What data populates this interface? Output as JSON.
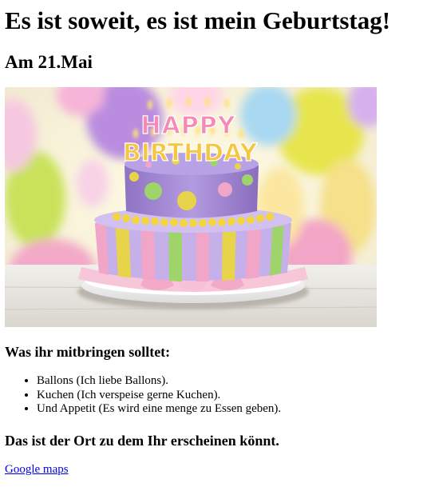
{
  "page": {
    "title": "Es ist soweit, es ist mein Geburtstag!",
    "date_heading": "Am 21.Mai"
  },
  "image": {
    "topper_row1": "HAPPY",
    "topper_row2": "BIRTHDAY",
    "colors": {
      "cake_purple": "#a98ad8",
      "cake_pink": "#f2a6c7",
      "cake_yellow": "#e8d44a",
      "cake_green": "#9fd46a",
      "plate_pink": "#f7c6d8"
    }
  },
  "bring": {
    "heading": "Was ihr mitbringen solltet:",
    "items": [
      "Ballons (Ich liebe Ballons).",
      "Kuchen (Ich verspeise gerne Kuchen).",
      "Und Appetit (Es wird eine menge zu Essen geben)."
    ]
  },
  "place": {
    "heading": "Das ist der Ort zu dem Ihr erscheinen könnt.",
    "link_label": "Google maps"
  }
}
